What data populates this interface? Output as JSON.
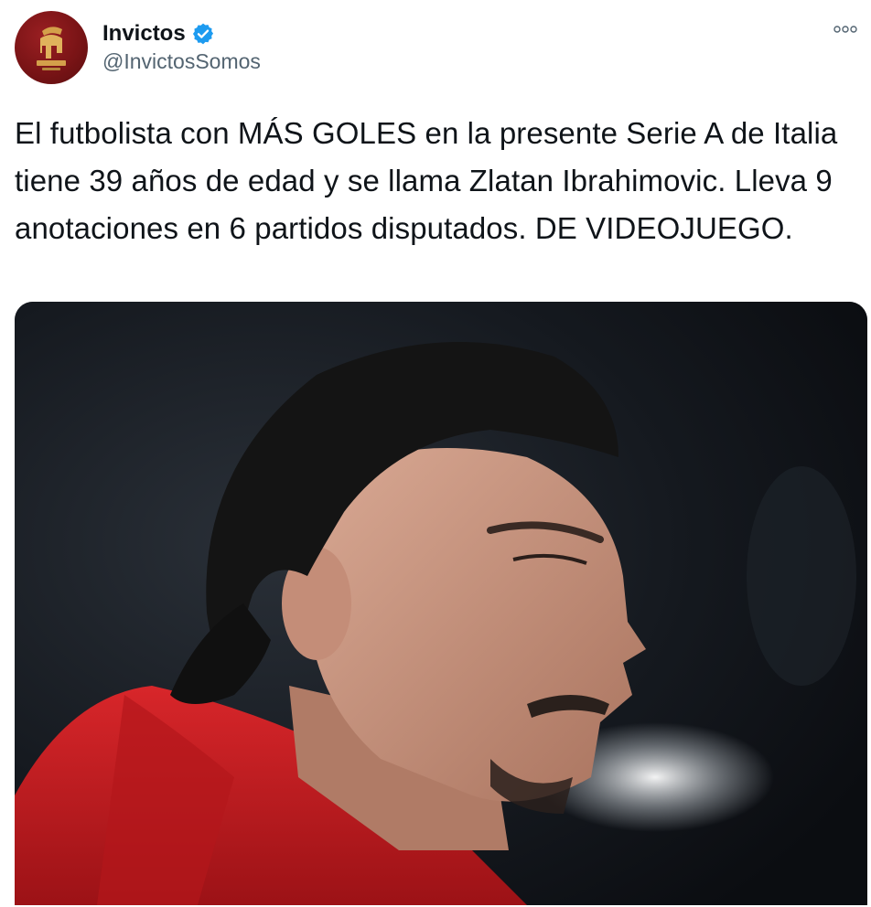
{
  "tweet": {
    "display_name": "Invictos",
    "handle": "@InvictosSomos",
    "verified": true,
    "text": "El futbolista con MÁS GOLES en la presente Serie A de Italia tiene 39 años de edad y se llama Zlatan Ibrahimovic. Lleva 9 anotaciones en 6 partidos disputados. DE VIDEOJUEGO."
  },
  "icons": {
    "avatar": "spartan-helmet-logo",
    "verified": "verified-badge-icon",
    "more": "more-options-icon"
  },
  "colors": {
    "verified_blue": "#1d9bf0",
    "avatar_red": "#7a1416",
    "hoodie_red": "#c81e22",
    "text_primary": "#0f1419",
    "text_secondary": "#536471"
  }
}
